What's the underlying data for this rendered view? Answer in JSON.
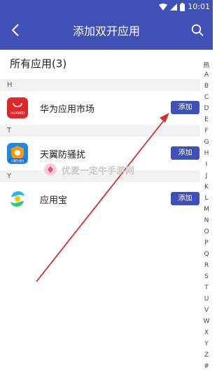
{
  "status_bar": {
    "time": "10:01",
    "icons": [
      "wifi-icon",
      "signal-icon",
      "battery-icon"
    ]
  },
  "app_bar": {
    "title": "添加双开应用",
    "back_icon": "chevron-left-icon",
    "search_icon": "search-icon"
  },
  "section": {
    "title": "所有应用(3)"
  },
  "groups": [
    {
      "letter": "H",
      "apps": [
        {
          "name": "华为应用市场",
          "icon": "huawei-appgallery-icon",
          "icon_text": "HUAWEI",
          "action": "添加"
        }
      ]
    },
    {
      "letter": "T",
      "apps": [
        {
          "name": "天翼防骚扰",
          "icon": "tianyi-antiharass-icon",
          "icon_text": "天翼防骚扰",
          "action": "添加"
        }
      ]
    },
    {
      "letter": "Y",
      "apps": [
        {
          "name": "应用宝",
          "icon": "yingyongbao-icon",
          "action": "添加"
        }
      ]
    }
  ],
  "index_bar": {
    "letters": [
      "热",
      "A",
      "B",
      "C",
      "D",
      "E",
      "F",
      "G",
      "H",
      "I",
      "J",
      "K",
      "L",
      "M",
      "N",
      "O",
      "P",
      "Q",
      "R",
      "S",
      "T",
      "U",
      "V",
      "W",
      "X",
      "Y",
      "Z",
      "#"
    ]
  },
  "watermark": {
    "text": "优麦一定牛手游网"
  },
  "colors": {
    "primary": "#3f51b5",
    "arrow": "#d32f2f",
    "huawei_red": "#e0262b"
  }
}
